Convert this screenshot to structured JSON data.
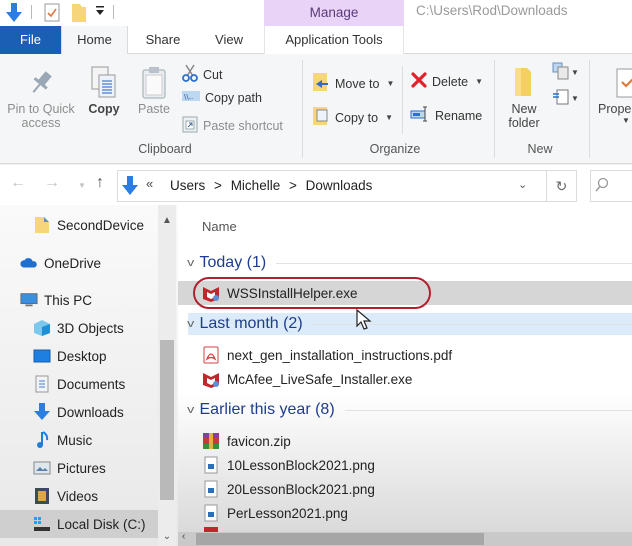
{
  "window": {
    "title_path": "C:\\Users\\Rod\\Downloads",
    "contextual_tab_group": "Manage"
  },
  "quick_access_toolbar": {
    "icons": [
      "down-arrow-icon",
      "properties-icon",
      "new-folder-icon",
      "customize-dropdown-icon"
    ]
  },
  "ribbon_tabs": [
    {
      "label": "File",
      "active": false
    },
    {
      "label": "Home",
      "active": true
    },
    {
      "label": "Share",
      "active": false
    },
    {
      "label": "View",
      "active": false
    },
    {
      "label": "Application Tools",
      "active": false
    }
  ],
  "ribbon": {
    "clipboard": {
      "label": "Clipboard",
      "pin_to_quick_access": [
        "Pin to Quick",
        "access"
      ],
      "copy": "Copy",
      "paste": "Paste",
      "cut": "Cut",
      "copy_path": "Copy path",
      "paste_shortcut": "Paste shortcut"
    },
    "organize": {
      "label": "Organize",
      "move_to": "Move to",
      "copy_to": "Copy to",
      "delete": "Delete",
      "rename": "Rename"
    },
    "new": {
      "label": "New",
      "new_folder": [
        "New",
        "folder"
      ]
    },
    "open": {
      "properties": "Prope"
    }
  },
  "address_bar": {
    "overflow": "«",
    "crumbs": [
      "Users",
      "Michelle",
      "Downloads"
    ],
    "separator": ">"
  },
  "sidebar": {
    "items": [
      {
        "label": "SecondDevice",
        "icon": "folder-icon"
      },
      {
        "label": "OneDrive",
        "icon": "cloud-icon"
      },
      {
        "label": "This PC",
        "icon": "computer-icon"
      },
      {
        "label": "3D Objects",
        "icon": "cube-icon"
      },
      {
        "label": "Desktop",
        "icon": "desktop-icon"
      },
      {
        "label": "Documents",
        "icon": "documents-icon"
      },
      {
        "label": "Downloads",
        "icon": "download-icon"
      },
      {
        "label": "Music",
        "icon": "music-icon"
      },
      {
        "label": "Pictures",
        "icon": "pictures-icon"
      },
      {
        "label": "Videos",
        "icon": "videos-icon"
      },
      {
        "label": "Local Disk (C:)",
        "icon": "drive-icon",
        "selected": true
      }
    ]
  },
  "content": {
    "column_header": "Name",
    "groups": [
      {
        "label": "Today (1)",
        "files": [
          {
            "name": "WSSInstallHelper.exe",
            "icon": "mcafee-icon",
            "selected": true,
            "highlighted": true
          }
        ]
      },
      {
        "label": "Last month (2)",
        "files": [
          {
            "name": "next_gen_installation_instructions.pdf",
            "icon": "pdf-icon"
          },
          {
            "name": "McAfee_LiveSafe_Installer.exe",
            "icon": "mcafee-icon"
          }
        ]
      },
      {
        "label": "Earlier this year (8)",
        "files": [
          {
            "name": "favicon.zip",
            "icon": "zip-archive-icon"
          },
          {
            "name": "10LessonBlock2021.png",
            "icon": "image-file-icon"
          },
          {
            "name": "20LessonBlock2021.png",
            "icon": "image-file-icon"
          },
          {
            "name": "PerLesson2021.png",
            "icon": "image-file-icon"
          }
        ]
      }
    ]
  },
  "colors": {
    "file_tab": "#1a5fb4",
    "manage_tab": "#e9d3f7",
    "group_header": "#1e3d8f",
    "highlight_oval": "#b21f2d",
    "selection": "#d6d6d6",
    "hover_row": "#dcebf9"
  }
}
